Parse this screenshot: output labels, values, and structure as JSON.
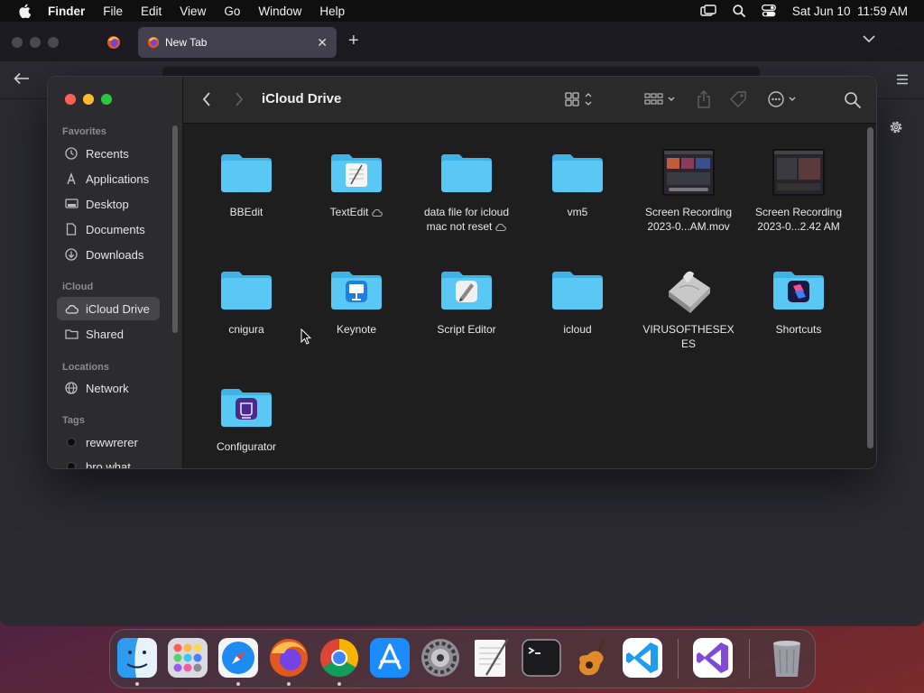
{
  "menubar": {
    "app_name": "Finder",
    "items": [
      "File",
      "Edit",
      "View",
      "Go",
      "Window",
      "Help"
    ],
    "clock": "Sat Jun 10  11:59 AM"
  },
  "browser": {
    "tab_title": "New Tab",
    "tab_close": "✕",
    "new_tab": "+"
  },
  "finder": {
    "title": "iCloud Drive",
    "sidebar": {
      "favorites_header": "Favorites",
      "favorites": [
        {
          "label": "Recents",
          "icon": "clock-icon"
        },
        {
          "label": "Applications",
          "icon": "applications-icon"
        },
        {
          "label": "Desktop",
          "icon": "desktop-icon"
        },
        {
          "label": "Documents",
          "icon": "document-icon"
        },
        {
          "label": "Downloads",
          "icon": "download-icon"
        }
      ],
      "icloud_header": "iCloud",
      "icloud": [
        {
          "label": "iCloud Drive",
          "icon": "cloud-icon",
          "selected": true
        },
        {
          "label": "Shared",
          "icon": "shared-folder-icon"
        }
      ],
      "locations_header": "Locations",
      "locations": [
        {
          "label": "Network",
          "icon": "globe-icon"
        }
      ],
      "tags_header": "Tags",
      "tags": [
        {
          "label": "rewwrerer",
          "color": "#111111"
        },
        {
          "label": "bro what",
          "color": "#111111"
        }
      ]
    },
    "items": [
      {
        "name": "BBEdit",
        "kind": "folder"
      },
      {
        "name": "TextEdit",
        "kind": "textedit-folder",
        "cloud": true
      },
      {
        "name": "data file for icloud mac not reset",
        "kind": "folder",
        "cloud": true
      },
      {
        "name": "vm5",
        "kind": "folder"
      },
      {
        "name": "Screen Recording 2023-0...AM.mov",
        "kind": "video"
      },
      {
        "name": "Screen Recording 2023-0...2.42 AM",
        "kind": "video"
      },
      {
        "name": "cnigura",
        "kind": "folder"
      },
      {
        "name": "Keynote",
        "kind": "keynote-folder"
      },
      {
        "name": "Script Editor",
        "kind": "script-folder"
      },
      {
        "name": "icloud",
        "kind": "folder"
      },
      {
        "name": "VIRUSOFTHESEXES",
        "kind": "script-file"
      },
      {
        "name": "Shortcuts",
        "kind": "shortcuts-folder"
      },
      {
        "name": "Configurator",
        "kind": "configurator-folder"
      }
    ]
  },
  "dock": {
    "apps": [
      "Finder",
      "Launchpad",
      "Safari",
      "Firefox",
      "Chrome",
      "App Store",
      "System Settings",
      "TextEdit",
      "Terminal",
      "GarageBand",
      "Visual Studio Code",
      "Visual Studio",
      "Trash"
    ]
  },
  "colors": {
    "folder_blue": "#5ac8f5",
    "selection": "#464649",
    "accent": "#0a84ff"
  }
}
